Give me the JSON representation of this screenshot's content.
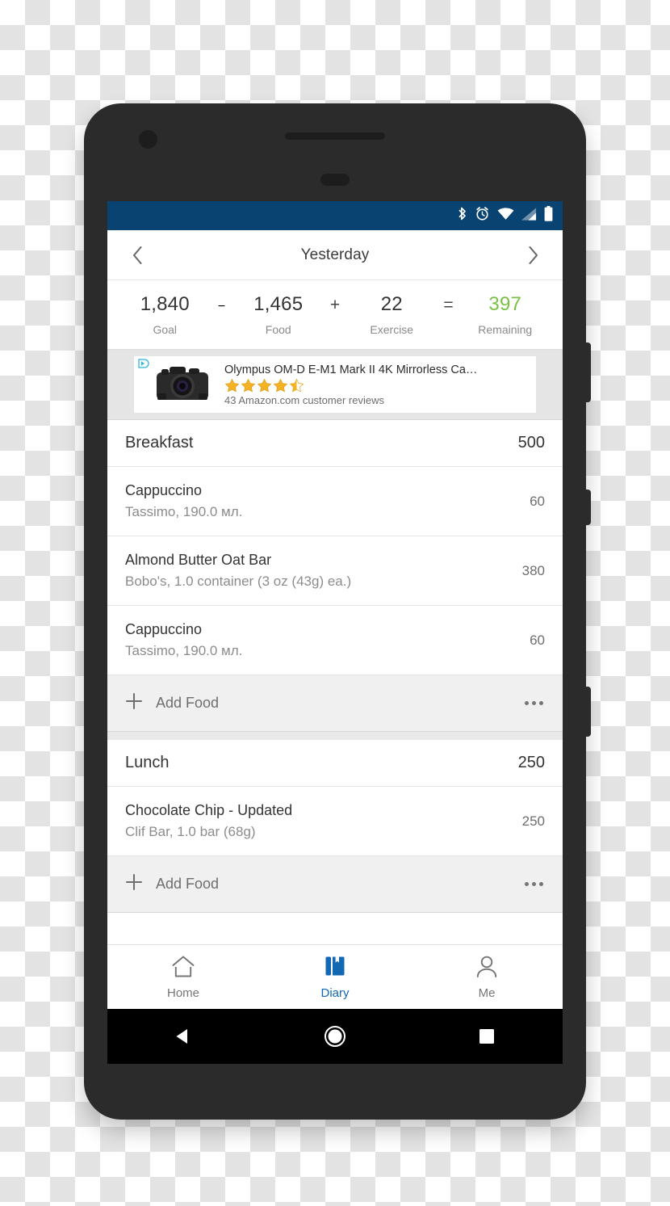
{
  "device": {
    "front_camera": "front-camera",
    "earpiece": "earpiece-speaker",
    "sensor": "proximity-sensor"
  },
  "status_bar": {
    "background": "#084371",
    "icons": [
      "bluetooth-icon",
      "alarm-icon",
      "wifi-icon",
      "cell-signal-icon",
      "battery-icon"
    ]
  },
  "header": {
    "prev_label": "chevron-left-icon",
    "date": "Yesterday",
    "next_label": "chevron-right-icon"
  },
  "summary": {
    "accent_color": "#7ac143",
    "cells": [
      {
        "value": "1,840",
        "label": "Goal"
      },
      {
        "value": "1,465",
        "label": "Food"
      },
      {
        "value": "22",
        "label": "Exercise"
      },
      {
        "value": "397",
        "label": "Remaining"
      }
    ],
    "operators": [
      "−",
      "+",
      "="
    ]
  },
  "ad": {
    "choices_label": "AdChoices",
    "title": "Olympus OM-D E-M1 Mark II 4K Mirrorless Ca…",
    "rating": 4.5,
    "reviews": "43 Amazon.com customer reviews"
  },
  "diary": {
    "meals": [
      {
        "name": "Breakfast",
        "calories": "500",
        "items": [
          {
            "name": "Cappuccino",
            "desc": "Tassimo, 190.0 мл.",
            "calories": "60"
          },
          {
            "name": "Almond Butter Oat Bar",
            "desc": "Bobo's, 1.0 container (3 oz (43g) ea.)",
            "calories": "380"
          },
          {
            "name": "Cappuccino",
            "desc": "Tassimo, 190.0 мл.",
            "calories": "60"
          }
        ],
        "add_label": "Add Food"
      },
      {
        "name": "Lunch",
        "calories": "250",
        "items": [
          {
            "name": "Chocolate Chip - Updated",
            "desc": "Clif Bar, 1.0 bar (68g)",
            "calories": "250"
          }
        ],
        "add_label": "Add Food"
      }
    ]
  },
  "tabs": [
    {
      "label": "Home",
      "icon": "home-icon",
      "active": false
    },
    {
      "label": "Diary",
      "icon": "diary-icon",
      "active": true
    },
    {
      "label": "Me",
      "icon": "person-icon",
      "active": false
    }
  ],
  "tab_active_color": "#1268b3",
  "android_nav": {
    "back": "back-triangle-icon",
    "home": "home-circle-icon",
    "recents": "recents-square-icon"
  }
}
